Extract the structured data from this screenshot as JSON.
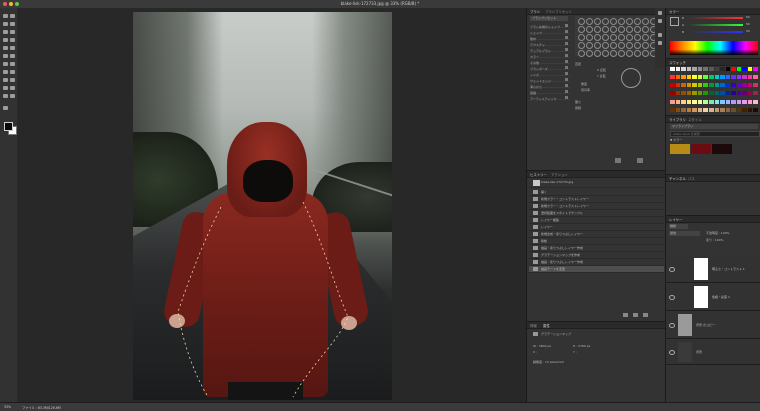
{
  "window": {
    "doc_title": "blake-lisk-172733.jpg @ 33% (RGB/8) *",
    "close_color": "#ec5f56",
    "min_color": "#f2bc2e",
    "max_color": "#5ec84a"
  },
  "brush_panel": {
    "tabs": [
      "ブラシ",
      "ブラシプリセット"
    ],
    "preset_button": "ブラシプリセット",
    "items": [
      "ブラシ先端のシェイプ",
      "シェイプ",
      "散布",
      "テクスチャ",
      "デュアルブラシ",
      "カラー",
      "その他",
      "ブラシポーズ",
      "ノイズ",
      "ウェットエッジ",
      "滑らかさ",
      "保護",
      "アーティスティック"
    ],
    "size_label": "直径",
    "flip_x_label": "X 反転",
    "flip_y_label": "Y 反転",
    "angle_label": "角度",
    "roundness_label": "真円率",
    "hardness_label": "硬さ",
    "spacing_label": "間隔"
  },
  "history_panel": {
    "tabs": [
      "ヒストリー",
      "アクション"
    ],
    "snapshot_label": "blake-lisk-172733.jpg",
    "items": [
      "開く",
      "新規カラー・コントラストレイヤー",
      "新規カラー・コントラストレイヤー",
      "選択範囲をスポイトでサンプル",
      "レイヤー複製",
      "レイヤー",
      "新規合成・塗りつぶしレイヤー",
      "移動",
      "描画・塗りつぶしレイヤー作成",
      "グラデーションマップを作成",
      "描画・塗りつぶしレイヤー作成",
      "描画モードを変更"
    ]
  },
  "properties_panel": {
    "tabs": [
      "情報",
      "属性"
    ],
    "title": "グラデーションマップ",
    "w_label": "W : 3840 px",
    "h_label": "H : 5760 px",
    "x_label": "X :",
    "y_label": "Y :",
    "doc_label": "解像度 : 72 pixel/inch"
  },
  "color_panel": {
    "tabs": [
      "カラー",
      "スウォッチ"
    ],
    "r_label": "R",
    "g_label": "G",
    "b_label": "B",
    "r_value": "50",
    "g_value": "50",
    "b_value": "50",
    "swatch_tab": "スウォッチ",
    "swatches": [
      "#ffffff",
      "#f0f0f0",
      "#d9d9d9",
      "#bfbfbf",
      "#a6a6a6",
      "#8c8c8c",
      "#737373",
      "#595959",
      "#404040",
      "#262626",
      "#000000",
      "#ff0000",
      "#00ff00",
      "#0000ff",
      "#ffff00",
      "#ff00ff",
      "#ff3333",
      "#ff6600",
      "#ff9900",
      "#ffcc00",
      "#ffff33",
      "#ccff33",
      "#66ff33",
      "#00cc66",
      "#00cccc",
      "#0099ff",
      "#3366ff",
      "#6633ff",
      "#9933ff",
      "#cc33cc",
      "#ff3399",
      "#ff6699",
      "#cc0000",
      "#cc3300",
      "#cc6600",
      "#cc9900",
      "#cccc00",
      "#99cc00",
      "#33cc00",
      "#009933",
      "#009999",
      "#0066cc",
      "#0033cc",
      "#3300cc",
      "#6600cc",
      "#990099",
      "#cc0066",
      "#cc3366",
      "#990000",
      "#993300",
      "#994d00",
      "#996600",
      "#999900",
      "#669900",
      "#269900",
      "#006633",
      "#006666",
      "#004d99",
      "#002699",
      "#260099",
      "#4d0099",
      "#660066",
      "#99004d",
      "#99264d",
      "#ff9999",
      "#ffb380",
      "#ffcc80",
      "#ffe680",
      "#ffff99",
      "#e6ff99",
      "#b3ff99",
      "#80e6b3",
      "#80e6e6",
      "#80c6ff",
      "#99b3ff",
      "#b399ff",
      "#cc99ff",
      "#e699e6",
      "#ff99cc",
      "#ffb3cc",
      "#663300",
      "#804d1a",
      "#996633",
      "#b38040",
      "#cc9966",
      "#e6b380",
      "#f2d0a6",
      "#d9b38c",
      "#bf9973",
      "#a6805a",
      "#8c6640",
      "#734d26",
      "#59330d",
      "#402000",
      "#261300",
      "#1a0d00",
      "#334d66",
      "#4d6680",
      "#668099",
      "#8099b3",
      "#99b3cc",
      "#b3cce6",
      "#cce0f2",
      "#e6f0fa",
      "#f2f7fc",
      "#dde7ef",
      "#c4d4e0",
      "#a8bfd0",
      "#8ca9bf",
      "#7094ad",
      "#557e9c",
      "#3b688a",
      "#1a1a33",
      "#26264d",
      "#333366",
      "#404080",
      "#4d4d99",
      "#5959b3",
      "#6666cc",
      "#7373e6",
      "#8080ff",
      "#9999ff",
      "#b3b3ff",
      "#ccccff",
      "#e6e6ff",
      "#f2f2ff",
      "#ffe6f2",
      "#ffcce6"
    ]
  },
  "libraries_panel": {
    "tabs": [
      "ライブラリ",
      "スタイル"
    ],
    "library_name": "マイライブラリ",
    "search_placeholder": "Adobe Stock を検索",
    "section": "▼ カラー",
    "colors": [
      "#b88a16",
      "#6a0c12",
      "#1a0a0a"
    ]
  },
  "channels_tabs": [
    "チャンネル",
    "パス"
  ],
  "layers_panel": {
    "tab": "レイヤー",
    "kind_label": "種類",
    "mode_label": "通常",
    "opacity_label": "不透明度 : 100%",
    "fill_label": "塗り : 100%",
    "layers": [
      {
        "name": "明るさ・コントラスト 1",
        "thumb": "#ffffff"
      },
      {
        "name": "色相・彩度 1",
        "thumb": "#ffffff"
      },
      {
        "name": "背景 のコピー",
        "thumb": "#9a9a9a"
      },
      {
        "name": "背景",
        "thumb": "#3a3a3a"
      }
    ]
  },
  "status": {
    "zoom": "33%",
    "doc_size": "ファイル : 63.3M/126.6M"
  }
}
